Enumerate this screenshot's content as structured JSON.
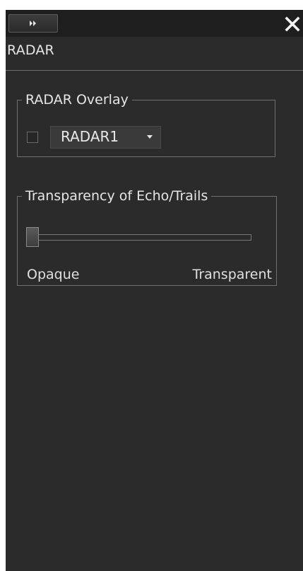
{
  "panel": {
    "title": "RADAR",
    "expand_icon": "double-chevron-right-icon",
    "close_icon": "close-x-icon"
  },
  "overlay": {
    "legend": "RADAR Overlay",
    "checked": false,
    "selected": "RADAR1"
  },
  "transparency": {
    "legend": "Transparency of Echo/Trails",
    "value_fraction": 0.0,
    "min_label": "Opaque",
    "max_label": "Transparent"
  },
  "colors": {
    "panel_bg": "#2b2b2b",
    "topbar_bg": "#1e1e1e",
    "text": "#e6e6e6",
    "border": "#6f6f6f"
  }
}
